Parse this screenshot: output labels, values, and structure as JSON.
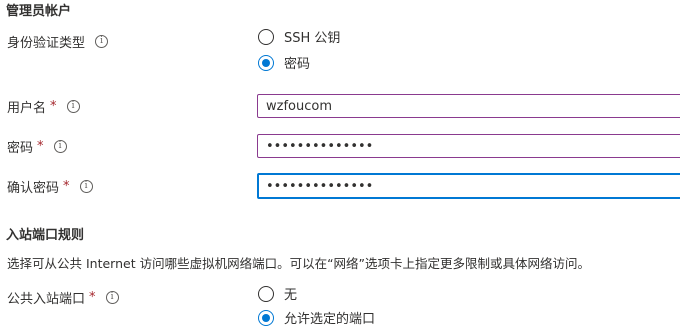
{
  "admin_section": {
    "title": "管理员帐户",
    "auth_type": {
      "label": "身份验证类型",
      "options": [
        {
          "label": "SSH 公钥",
          "selected": false
        },
        {
          "label": "密码",
          "selected": true
        }
      ]
    },
    "username": {
      "label": "用户名",
      "required_mark": "*",
      "value": "wzfoucom"
    },
    "password": {
      "label": "密码",
      "required_mark": "*",
      "value": "••••••••••••••"
    },
    "confirm_password": {
      "label": "确认密码",
      "required_mark": "*",
      "value": "••••••••••••••"
    }
  },
  "inbound_section": {
    "title": "入站端口规则",
    "description": "选择可从公共 Internet 访问哪些虚拟机网络端口。可以在“网络”选项卡上指定更多限制或具体网络访问。",
    "public_ports": {
      "label": "公共入站端口",
      "required_mark": "*",
      "options": [
        {
          "label": "无",
          "selected": false
        },
        {
          "label": "允许选定的端口",
          "selected": true
        }
      ]
    }
  },
  "info_glyph": "i",
  "colors": {
    "accent": "#0078d4",
    "required": "#a4262c"
  }
}
